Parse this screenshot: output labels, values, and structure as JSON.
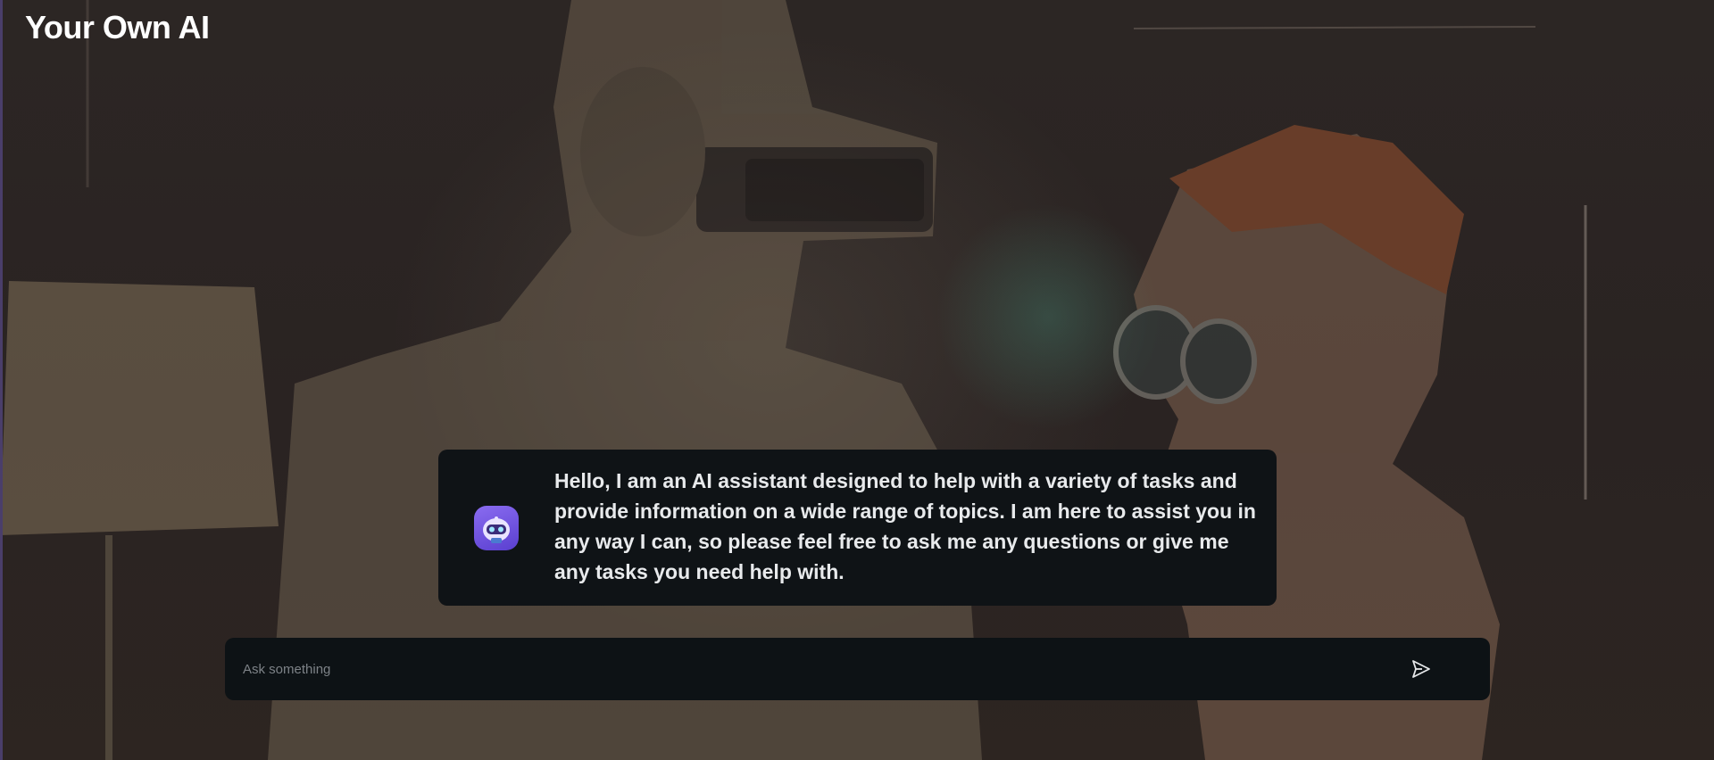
{
  "app": {
    "title": "Your Own AI"
  },
  "chat": {
    "messages": [
      {
        "role": "assistant",
        "avatar": "robot-avatar-icon",
        "text": "Hello, I am an AI assistant designed to help with a variety of tasks and provide information on a wide range of topics. I am here to assist you in any way I can, so please feel free to ask me any questions or give me any tasks you need help with."
      }
    ]
  },
  "composer": {
    "placeholder": "Ask something",
    "value": "",
    "send_icon": "send-icon"
  },
  "colors": {
    "accent": "#7b5cf0",
    "panel": "#0f1316",
    "background": "#2a2422"
  }
}
